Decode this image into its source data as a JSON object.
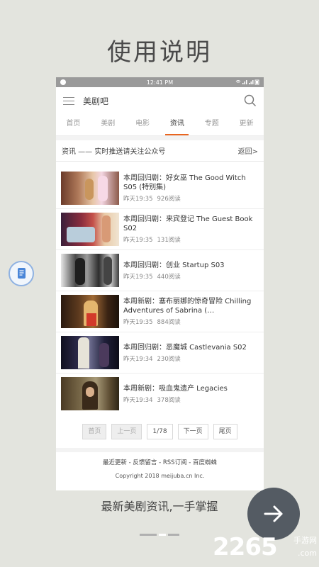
{
  "intro": {
    "title": "使用说明",
    "caption": "最新美剧资讯,一手掌握"
  },
  "status_bar": {
    "time": "12:41 PM"
  },
  "app_bar": {
    "title": "美剧吧"
  },
  "tabs": [
    "首页",
    "美剧",
    "电影",
    "资讯",
    "专题",
    "更新"
  ],
  "active_tab": "资讯",
  "notice": {
    "text": "资讯 —— 实时推送请关注公众号",
    "back": "返回>"
  },
  "news": [
    {
      "title": "本周回归剧：好女巫 The Good Witch S05 (特别集)",
      "time": "昨天19:35",
      "reads": "926阅读"
    },
    {
      "title": "本周回归剧：来宾登记 The Guest Book S02",
      "time": "昨天19:35",
      "reads": "131阅读"
    },
    {
      "title": "本周回归剧：创业 Startup S03",
      "time": "昨天19:35",
      "reads": "440阅读"
    },
    {
      "title": "本周新剧：塞布丽娜的惊奇冒险 Chilling Adventures of Sabrina (…",
      "time": "昨天19:35",
      "reads": "884阅读"
    },
    {
      "title": "本周回归剧：恶魔城 Castlevania S02",
      "time": "昨天19:34",
      "reads": "230阅读"
    },
    {
      "title": "本周新剧：吸血鬼遗产 Legacies",
      "time": "昨天19:34",
      "reads": "378阅读"
    }
  ],
  "pagination": {
    "first": "首页",
    "prev": "上一页",
    "page": "1/78",
    "next": "下一页",
    "last": "尾页"
  },
  "footer": {
    "links": "最近更新 - 反馈留言 - RSS订阅 - 百度蜘蛛",
    "copyright": "Copyright 2018 meijuba.cn Inc."
  },
  "watermark": {
    "number": "2265",
    "suffix": ".com",
    "text": "手游网"
  },
  "colors": {
    "accent": "#e9651f",
    "background": "#e3e4de",
    "fab": "#545b63"
  }
}
